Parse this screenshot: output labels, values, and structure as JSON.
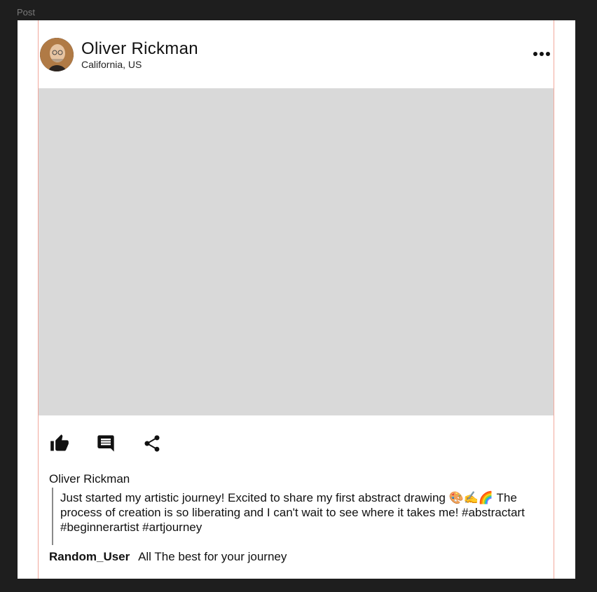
{
  "frame": {
    "label": "Post"
  },
  "post": {
    "author": {
      "name": "Oliver Rickman",
      "location": "California, US"
    },
    "more_icon": "ellipsis-icon",
    "actions": [
      {
        "name": "like",
        "icon": "thumbs-up-icon"
      },
      {
        "name": "comment",
        "icon": "comment-icon"
      },
      {
        "name": "share",
        "icon": "share-icon"
      }
    ],
    "caption": {
      "author": "Oliver Rickman",
      "text": "Just started my artistic journey! Excited to share my first abstract drawing 🎨✍️🌈 The process of creation is so liberating and I can't wait to see where it takes me! #abstractart #beginnerartist #artjourney"
    },
    "comments": [
      {
        "user": "Random_User",
        "text": "All The best for your journey"
      }
    ]
  },
  "colors": {
    "canvas_background": "#1e1e1e",
    "card_background": "#ffffff",
    "media_placeholder": "#d9d9d9",
    "guide_line": "#f2a89c"
  }
}
